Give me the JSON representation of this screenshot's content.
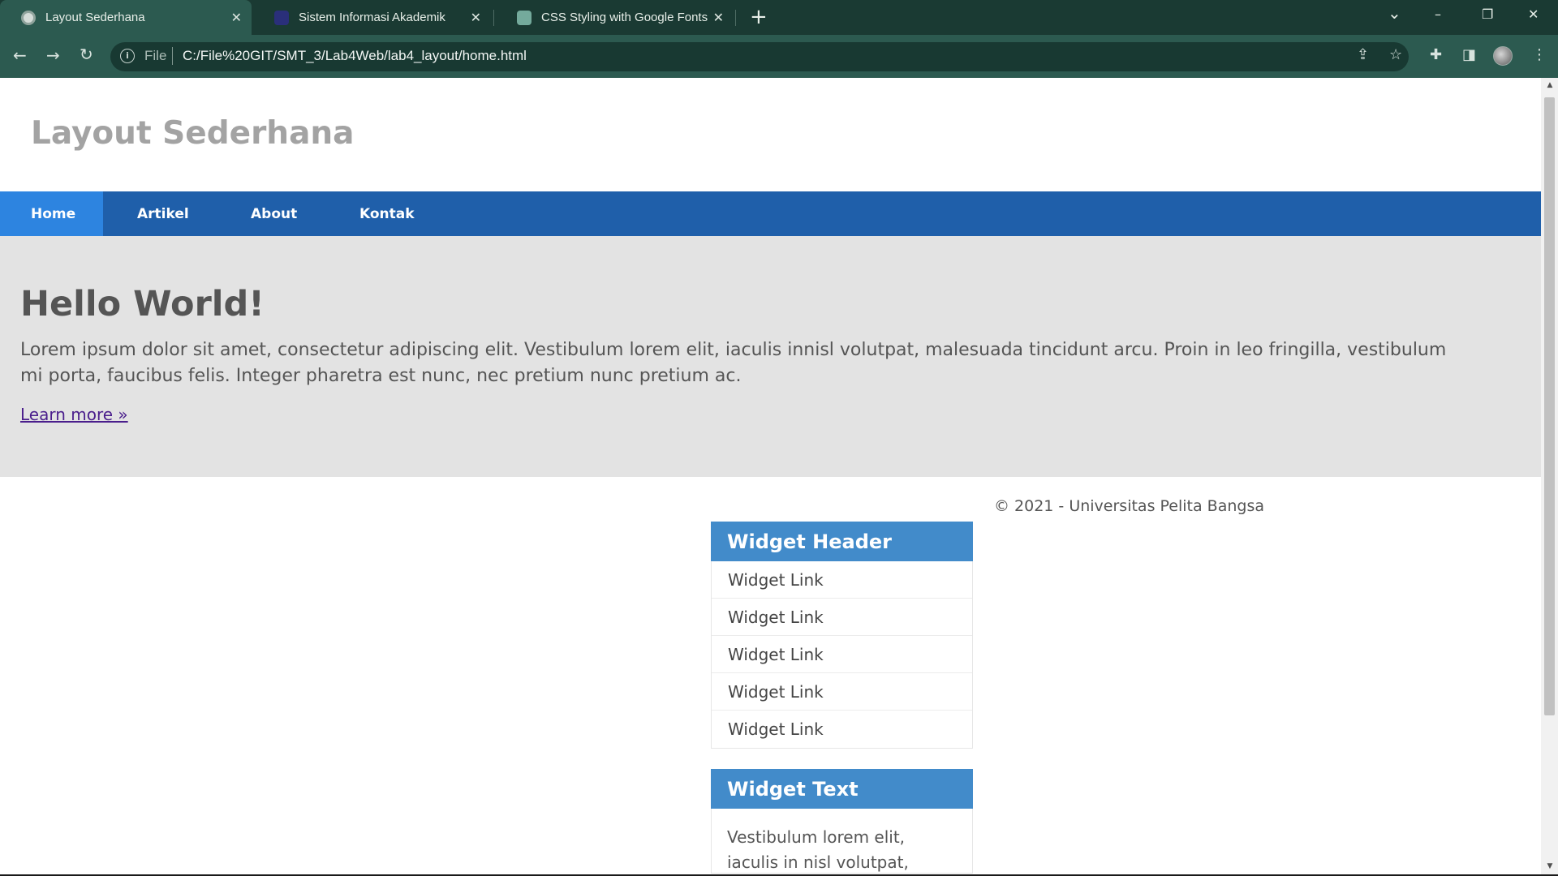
{
  "browser": {
    "tabs": [
      {
        "title": "Layout Sederhana",
        "close": "✕",
        "active": true
      },
      {
        "title": "Sistem Informasi Akademik",
        "close": "✕",
        "active": false
      },
      {
        "title": "CSS Styling with Google Fonts",
        "close": "✕",
        "active": false
      }
    ],
    "new_tab": "+",
    "window": {
      "dropdown": "⌄",
      "minimize": "–",
      "restore": "❐",
      "close": "✕"
    },
    "address": {
      "scheme_label": "File",
      "url": "C:/File%20GIT/SMT_3/Lab4Web/lab4_layout/home.html"
    }
  },
  "page": {
    "site_title": "Layout Sederhana",
    "nav": [
      "Home",
      "Artikel",
      "About",
      "Kontak"
    ],
    "hero": {
      "heading": "Hello World!",
      "text": "Lorem ipsum dolor sit amet, consectetur adipiscing elit. Vestibulum lorem elit, iaculis innisl volutpat, malesuada tincidunt arcu. Proin in leo fringilla, vestibulum mi porta, faucibus felis. Integer pharetra est nunc, nec pretium nunc pretium ac.",
      "link": "Learn more »"
    },
    "footer": "© 2021 - Universitas Pelita Bangsa",
    "widget_links": {
      "header": "Widget Header",
      "links": [
        "Widget Link",
        "Widget Link",
        "Widget Link",
        "Widget Link",
        "Widget Link"
      ]
    },
    "widget_text": {
      "header": "Widget Text",
      "body": "Vestibulum lorem elit, iaculis in nisl volutpat, malesuada"
    }
  },
  "colors": {
    "tabstrip": "#1a3a33",
    "toolbar": "#2c5a50",
    "nav_bar": "#1f5faa",
    "nav_active": "#2d84e0",
    "hero_bg": "#e3e3e3",
    "widget_header": "#428bca"
  }
}
